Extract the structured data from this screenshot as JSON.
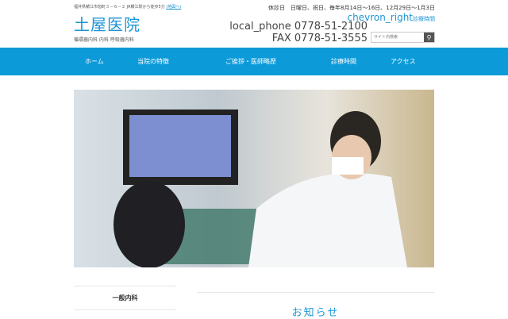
{
  "header": {
    "address": "福井県鯖江市旭町３－６－２ JR鯖江駅から徒歩5分",
    "map_link": "(地図へ)",
    "logo": "土屋医院",
    "subtitle": "循環器内科 内科 呼吸器内科",
    "closed_days": "休診日　日曜日、祝日、毎年8月14日～16日、12月29日～1月3日",
    "hours_icon": "chevron_right",
    "hours_link": "診療時間",
    "phone_icon": "local_phone",
    "phone": "0778-51-2100",
    "fax": "FAX 0778-51-3555",
    "search_placeholder": "サイト内検索"
  },
  "nav": [
    "ホーム",
    "当院の特徴",
    "ご挨拶・医師略歴",
    "診療時間",
    "アクセス"
  ],
  "sidebar": {
    "item": "一般内科"
  },
  "main": {
    "news_title": "お知らせ"
  }
}
